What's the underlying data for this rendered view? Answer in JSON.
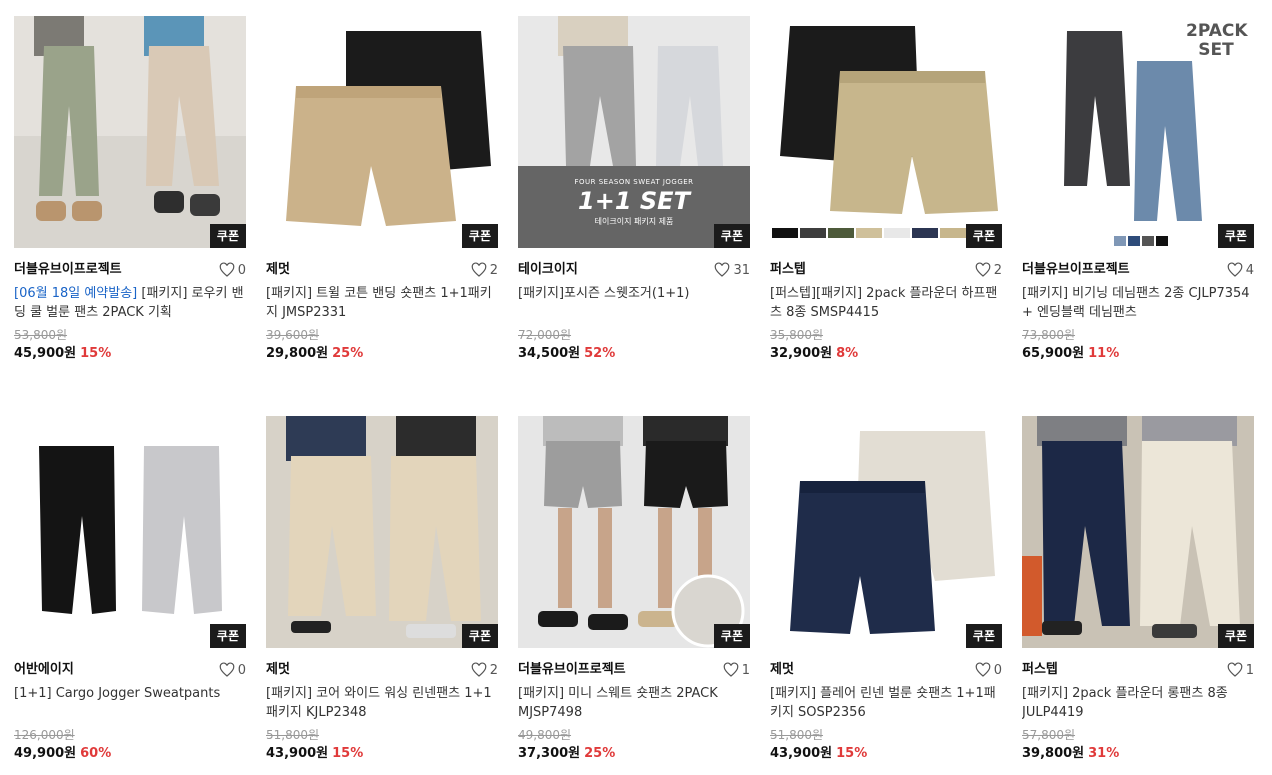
{
  "products": [
    {
      "brand": "더블유브이프로젝트",
      "likes": "0",
      "tag": "[06월 18일 예약발송]",
      "title": " [패키지] 로우키 밴딩 쿨 벌룬 팬츠 2PACK 기획",
      "original_price": "53,800원",
      "price": "45,900원",
      "discount": "15%",
      "coupon": "쿠폰",
      "image": "two-models-green-beige-pants"
    },
    {
      "brand": "제멋",
      "likes": "2",
      "tag": "",
      "title": "[패키지] 트윌 코튼 밴딩 숏팬츠 1+1패키지 JMSP2331",
      "original_price": "39,600원",
      "price": "29,800원",
      "discount": "25%",
      "coupon": "쿠폰",
      "image": "black-beige-shorts"
    },
    {
      "brand": "테이크이지",
      "likes": "31",
      "tag": "",
      "title": "[패키지]포시즌 스웻조거(1+1)",
      "original_price": "72,000원",
      "price": "34,500원",
      "discount": "52%",
      "coupon": "쿠폰",
      "image": "grey-sweat-jogger-set",
      "overlay": {
        "small": "FOUR SEASON SWEAT JOGGER",
        "big": "1+1 SET",
        "sub": "테이크이지 패키지 제품"
      }
    },
    {
      "brand": "퍼스텝",
      "likes": "2",
      "tag": "",
      "title": "[퍼스텝][패키지] 2pack 플라운더 하프팬츠 8종 SMSP4415",
      "original_price": "35,800원",
      "price": "32,900원",
      "discount": "8%",
      "coupon": "쿠폰",
      "image": "black-beige-half-pants"
    },
    {
      "brand": "더블유브이프로젝트",
      "likes": "4",
      "tag": "",
      "title": "[패키지] 비기닝 데님팬츠 2종 CJLP7354 + 엔딩블랙 데님팬츠",
      "original_price": "73,800원",
      "price": "65,900원",
      "discount": "11%",
      "coupon": "쿠폰",
      "image": "two-denim-pants",
      "overlay": {
        "big": "2PACK SET"
      }
    },
    {
      "brand": "어반에이지",
      "likes": "0",
      "tag": "",
      "title": "[1+1] Cargo Jogger Sweatpants",
      "original_price": "126,000원",
      "price": "49,900원",
      "discount": "60%",
      "coupon": "쿠폰",
      "image": "black-grey-cargo-joggers"
    },
    {
      "brand": "제멋",
      "likes": "2",
      "tag": "",
      "title": "[패키지] 코어 와이드 워싱 린넨팬츠 1+1패키지 KJLP2348",
      "original_price": "51,800원",
      "price": "43,900원",
      "discount": "15%",
      "coupon": "쿠폰",
      "image": "two-models-linen-pants"
    },
    {
      "brand": "더블유브이프로젝트",
      "likes": "1",
      "tag": "",
      "title": "[패키지] 미니 스웨트 숏팬츠 2PACK MJSP7498",
      "original_price": "49,800원",
      "price": "37,300원",
      "discount": "25%",
      "coupon": "쿠폰",
      "image": "two-models-sweat-shorts"
    },
    {
      "brand": "제멋",
      "likes": "0",
      "tag": "",
      "title": "[패키지] 플레어 린넨 벌룬 숏팬츠 1+1패키지 SOSP2356",
      "original_price": "51,800원",
      "price": "43,900원",
      "discount": "15%",
      "coupon": "쿠폰",
      "image": "navy-cream-shorts"
    },
    {
      "brand": "퍼스텝",
      "likes": "1",
      "tag": "",
      "title": "[패키지] 2pack 플라운더 롱팬츠 8종 JULP4419",
      "original_price": "57,800원",
      "price": "39,800원",
      "discount": "31%",
      "coupon": "쿠폰",
      "image": "two-models-navy-cream-pants"
    }
  ],
  "colors": {
    "accent_discount": "#e03a3a",
    "tag_blue": "#1a64c7",
    "coupon_bg": "#1b1b1b"
  }
}
